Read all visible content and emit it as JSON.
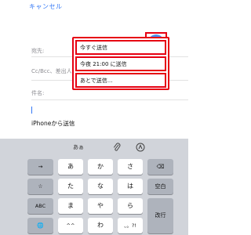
{
  "nav": {
    "cancel_label": "キャンセル"
  },
  "mail": {
    "to_label": "宛先:",
    "cc_label": "Cc/Bcc、差出人:",
    "subject_label": "件名:",
    "signature": "iPhoneから送信"
  },
  "send_menu": {
    "items": [
      "今すぐ送信",
      "今夜 21:00 に送信",
      "あとで送信..."
    ]
  },
  "keyboard": {
    "topbar_aa": "あぁ",
    "row1": [
      "→",
      "あ",
      "か",
      "さ",
      "⌫"
    ],
    "row2": [
      "☆",
      "た",
      "な",
      "は",
      "空白"
    ],
    "row3": [
      "ABC",
      "ま",
      "や",
      "ら",
      "改行"
    ],
    "row4": [
      "🌐",
      "^^",
      "わ",
      "、。?!"
    ]
  },
  "colors": {
    "accent": "#3478f6",
    "highlight": "#e60012"
  }
}
